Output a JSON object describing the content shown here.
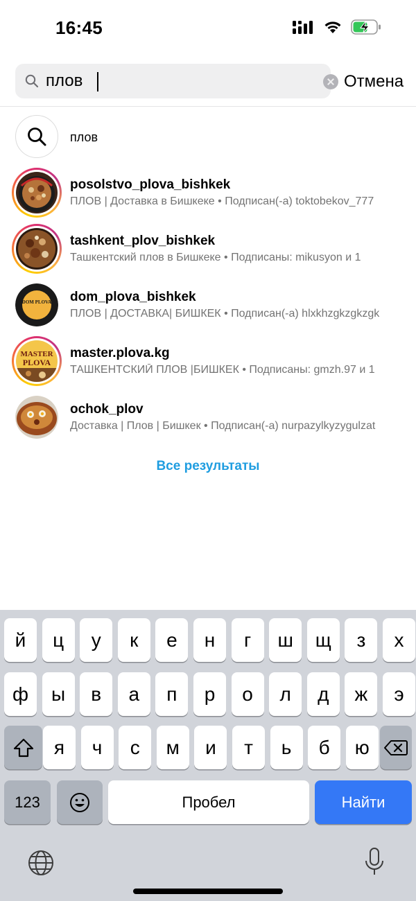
{
  "status_bar": {
    "time": "16:45"
  },
  "search": {
    "query": "плов",
    "cancel_label": "Отмена"
  },
  "query_suggestion": {
    "text": "плов"
  },
  "results": [
    {
      "username": "posolstvo_plova_bishkek",
      "subtitle": "ПЛОВ | Доставка в Бишкеке • Подписан(-а) toktobekov_777"
    },
    {
      "username": "tashkent_plov_bishkek",
      "subtitle": "Ташкентский плов в Бишкеке • Подписаны: mikusyon и 1"
    },
    {
      "username": "dom_plova_bishkek",
      "subtitle": "ПЛОВ | ДОСТАВКА| БИШКЕК • Подписан(-а) hlxkhzgkzgkzgk"
    },
    {
      "username": "master.plova.kg",
      "subtitle": "ТАШКЕНТСКИЙ ПЛОВ |БИШКЕК • Подписаны: gmzh.97 и 1"
    },
    {
      "username": "ochok_plov",
      "subtitle": "Доставка | Плов | Бишкек • Подписан(-а) nurpazylkyzygulzat"
    }
  ],
  "avatar_text": {
    "dom_logo": "DOM PLOVA",
    "master_logo_top": "MASTER",
    "master_logo_bottom": "PLOVA"
  },
  "all_results_label": "Все результаты",
  "keyboard": {
    "row1": [
      "й",
      "ц",
      "у",
      "к",
      "е",
      "н",
      "г",
      "ш",
      "щ",
      "з",
      "х"
    ],
    "row2": [
      "ф",
      "ы",
      "в",
      "а",
      "п",
      "р",
      "о",
      "л",
      "д",
      "ж",
      "э"
    ],
    "row3": [
      "я",
      "ч",
      "с",
      "м",
      "и",
      "т",
      "ь",
      "б",
      "ю"
    ],
    "numbers_label": "123",
    "space_label": "Пробел",
    "return_label": "Найти"
  },
  "colors": {
    "accent_link": "#1f9de0",
    "return_key": "#3478f6",
    "battery_charge": "#34c759"
  },
  "icons": [
    "signal-icon",
    "wifi-icon",
    "battery-charging-icon",
    "search-icon",
    "clear-icon",
    "shift-icon",
    "backspace-icon",
    "emoji-icon",
    "globe-icon",
    "microphone-icon"
  ]
}
